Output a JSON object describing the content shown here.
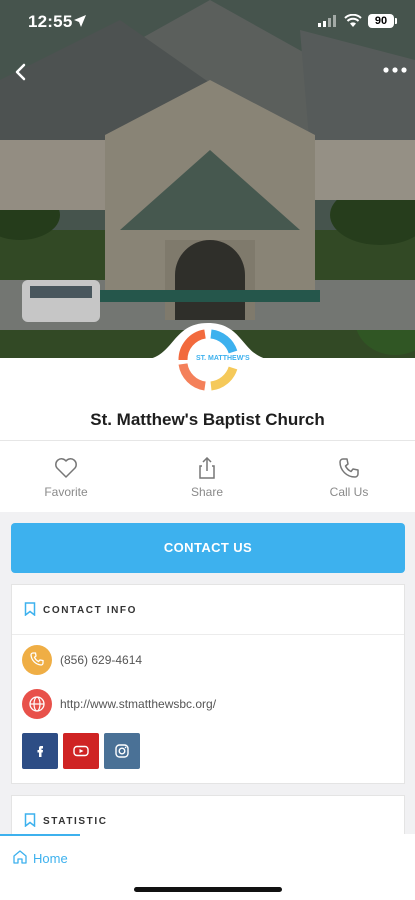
{
  "status_bar": {
    "time": "12:55",
    "battery": "90"
  },
  "header": {
    "title": "St. Matthew's Baptist Church",
    "logo_text": "ST. MATTHEW'S"
  },
  "actions": [
    {
      "label": "Favorite",
      "icon": "heart-icon"
    },
    {
      "label": "Share",
      "icon": "share-icon"
    },
    {
      "label": "Call Us",
      "icon": "phone-icon"
    }
  ],
  "contact_button": {
    "label": "CONTACT US"
  },
  "contact_info": {
    "heading": "CONTACT INFO",
    "phone": "(856) 629-4614",
    "website": "http://www.stmatthewsbc.org/",
    "socials": [
      "facebook-icon",
      "youtube-icon",
      "instagram-icon"
    ]
  },
  "statistic": {
    "heading": "STATISTIC"
  },
  "bottom_nav": {
    "home_label": "Home"
  },
  "colors": {
    "accent": "#3db1ee",
    "phone_circle": "#efae45",
    "web_circle": "#e8514a",
    "facebook": "#2d4d85",
    "youtube": "#cf2323",
    "instagram": "#4a7196"
  }
}
